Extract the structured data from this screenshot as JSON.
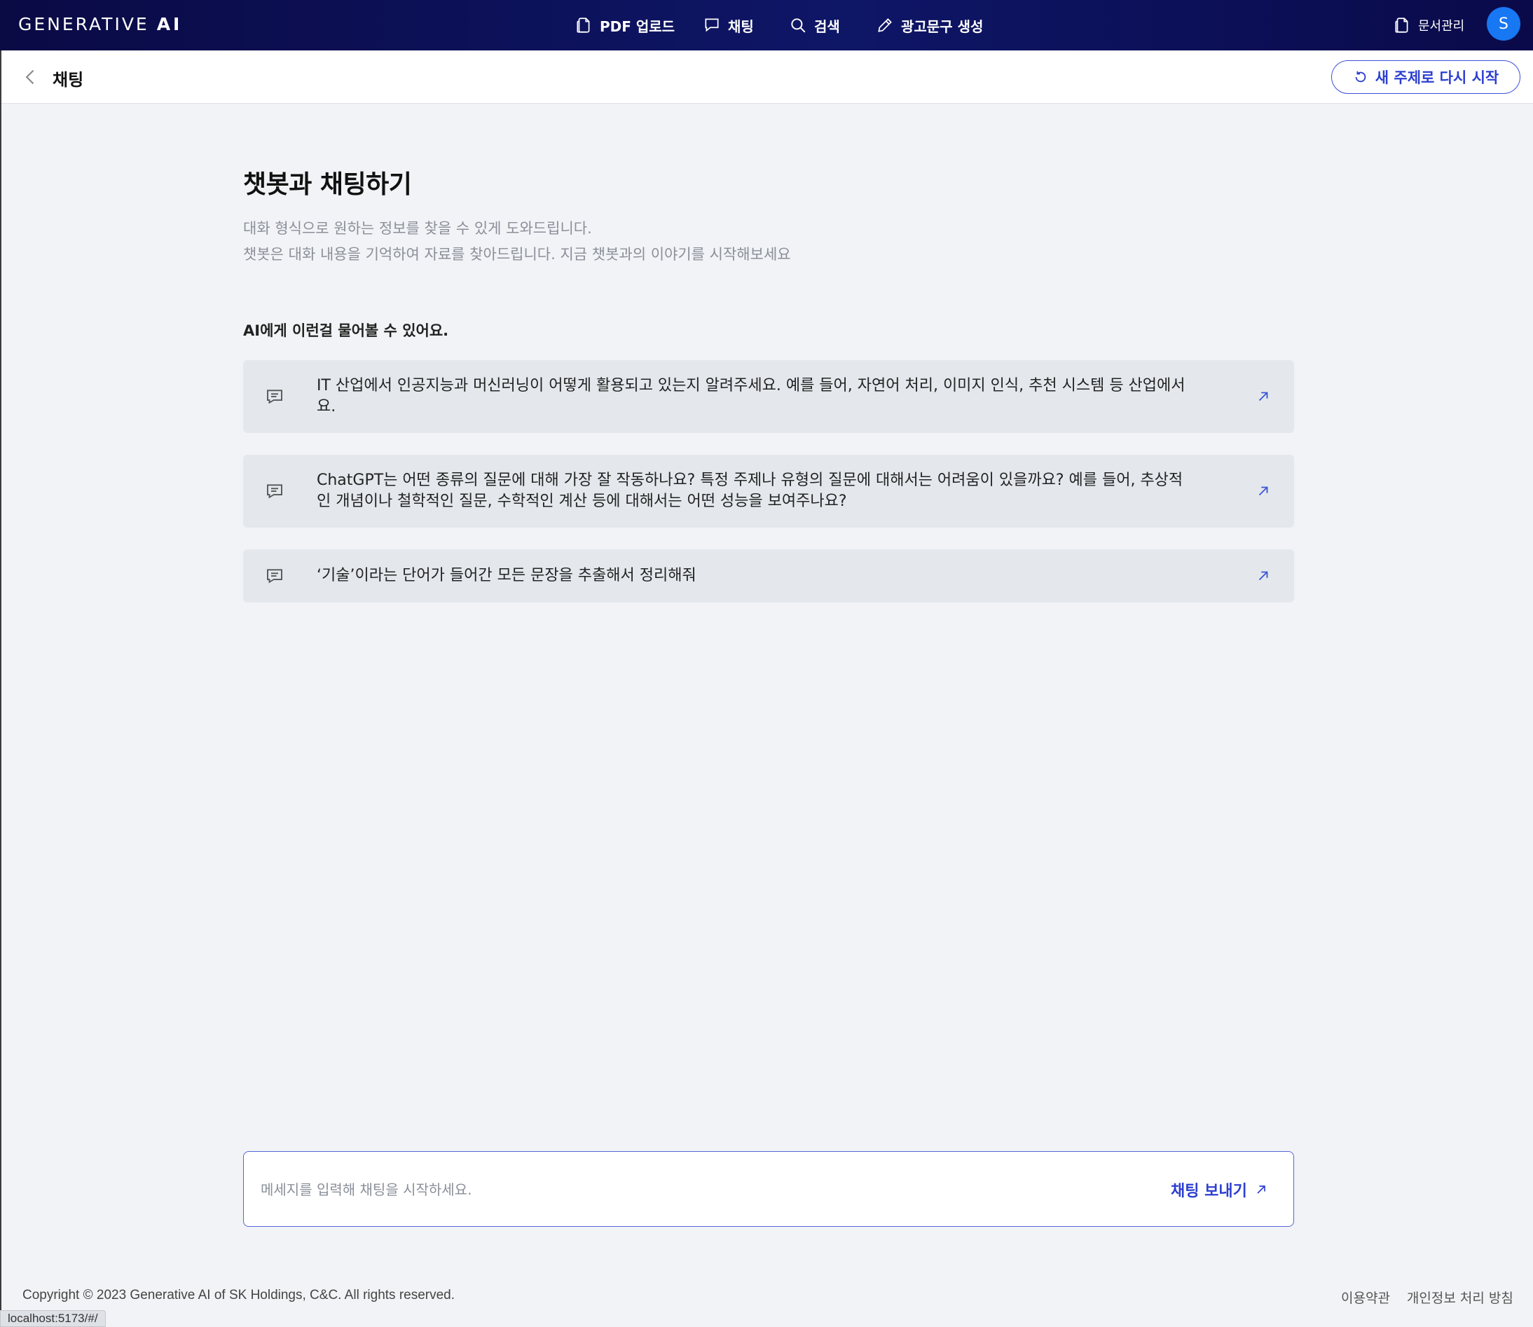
{
  "header": {
    "brand_light": "GENERATIVE ",
    "brand_bold": "AI",
    "nav": [
      {
        "label": "PDF 업로드",
        "icon": "document-icon"
      },
      {
        "label": "채팅",
        "icon": "chat-bubble-icon"
      },
      {
        "label": "검색",
        "icon": "search-icon"
      },
      {
        "label": "광고문구 생성",
        "icon": "pencil-icon"
      }
    ],
    "docs_label": "문서관리",
    "avatar_initial": "S"
  },
  "subheader": {
    "title": "채팅",
    "restart_label": "새 주제로 다시 시작"
  },
  "main": {
    "title": "챗봇과 채팅하기",
    "description_line1": "대화 형식으로 원하는 정보를 찾을 수 있게 도와드립니다.",
    "description_line2": "챗봇은 대화 내용을 기억하여 자료를 찾아드립니다. 지금 챗봇과의 이야기를 시작해보세요",
    "suggest_heading": "AI에게 이런걸 물어볼 수 있어요.",
    "suggestions": [
      {
        "text": "IT 산업에서 인공지능과 머신러닝이 어떻게 활용되고 있는지 알려주세요. 예를 들어, 자연어 처리, 이미지 인식, 추천 시스템 등 산업에서요."
      },
      {
        "text": "ChatGPT는 어떤 종류의 질문에 대해 가장 잘 작동하나요? 특정 주제나 유형의 질문에 대해서는 어려움이 있을까요? 예를 들어, 추상적인 개념이나 철학적인 질문, 수학적인 계산 등에 대해서는 어떤 성능을 보여주나요?"
      },
      {
        "text": "‘기술’이라는 단어가 들어간 모든 문장을 추출해서 정리해줘"
      }
    ]
  },
  "composer": {
    "placeholder": "메세지를 입력해 채팅을 시작하세요.",
    "value": "",
    "send_label": "채팅 보내기"
  },
  "footer": {
    "copyright": "Copyright © 2023 Generative AI of SK Holdings, C&C. All rights reserved.",
    "terms": "이용약관",
    "privacy": "개인정보 처리 방침"
  },
  "status_bar": {
    "url": "localhost:5173/#/"
  },
  "colors": {
    "header_bg": "#0e1666",
    "accent": "#2c3fd0",
    "avatar_bg": "#1877f2",
    "card_bg": "#e4e8ec",
    "page_bg": "#f2f3f6"
  }
}
